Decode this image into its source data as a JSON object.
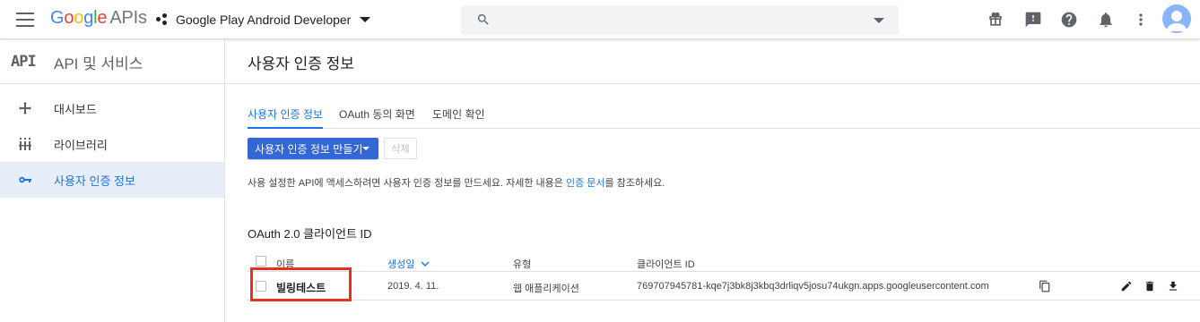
{
  "topbar": {
    "logo_google": [
      "G",
      "o",
      "o",
      "g",
      "l",
      "e"
    ],
    "logo_apis": "APIs",
    "project_name": "Google Play Android Developer",
    "search": {
      "value": "",
      "placeholder": ""
    }
  },
  "sidebar": {
    "logo": "API",
    "title": "API 및 서비스",
    "items": [
      {
        "label": "대시보드",
        "icon": "dashboard-icon",
        "active": false
      },
      {
        "label": "라이브러리",
        "icon": "library-icon",
        "active": false
      },
      {
        "label": "사용자 인증 정보",
        "icon": "key-icon",
        "active": true
      }
    ]
  },
  "main": {
    "page_title": "사용자 인증 정보",
    "tabs": [
      {
        "label": "사용자 인증 정보",
        "active": true
      },
      {
        "label": "OAuth 동의 화면",
        "active": false
      },
      {
        "label": "도메인 확인",
        "active": false
      }
    ],
    "create_button": "사용자 인증 정보 만들기",
    "delete_button": "삭제",
    "description_prefix": "사용 설정한 API에 액세스하려면 사용자 인증 정보를 만드세요. 자세한 내용은 ",
    "description_link": "인증 문서",
    "description_suffix": "를 참조하세요.",
    "section_title": "OAuth 2.0 클라이언트 ID",
    "table": {
      "columns": {
        "name": "이름",
        "created": "생성일",
        "type": "유형",
        "client_id": "클라이언트 ID"
      },
      "rows": [
        {
          "name": "빌링테스트",
          "created": "2019. 4. 11.",
          "type": "웹 애플리케이션",
          "client_id": "769707945781-kqe7j3bk8j3kbq3drliqv5josu74ukgn.apps.googleusercontent.com"
        }
      ]
    }
  },
  "colors": {
    "accent": "#1a73e8",
    "button": "#3367d6",
    "highlight": "#e8311a"
  }
}
